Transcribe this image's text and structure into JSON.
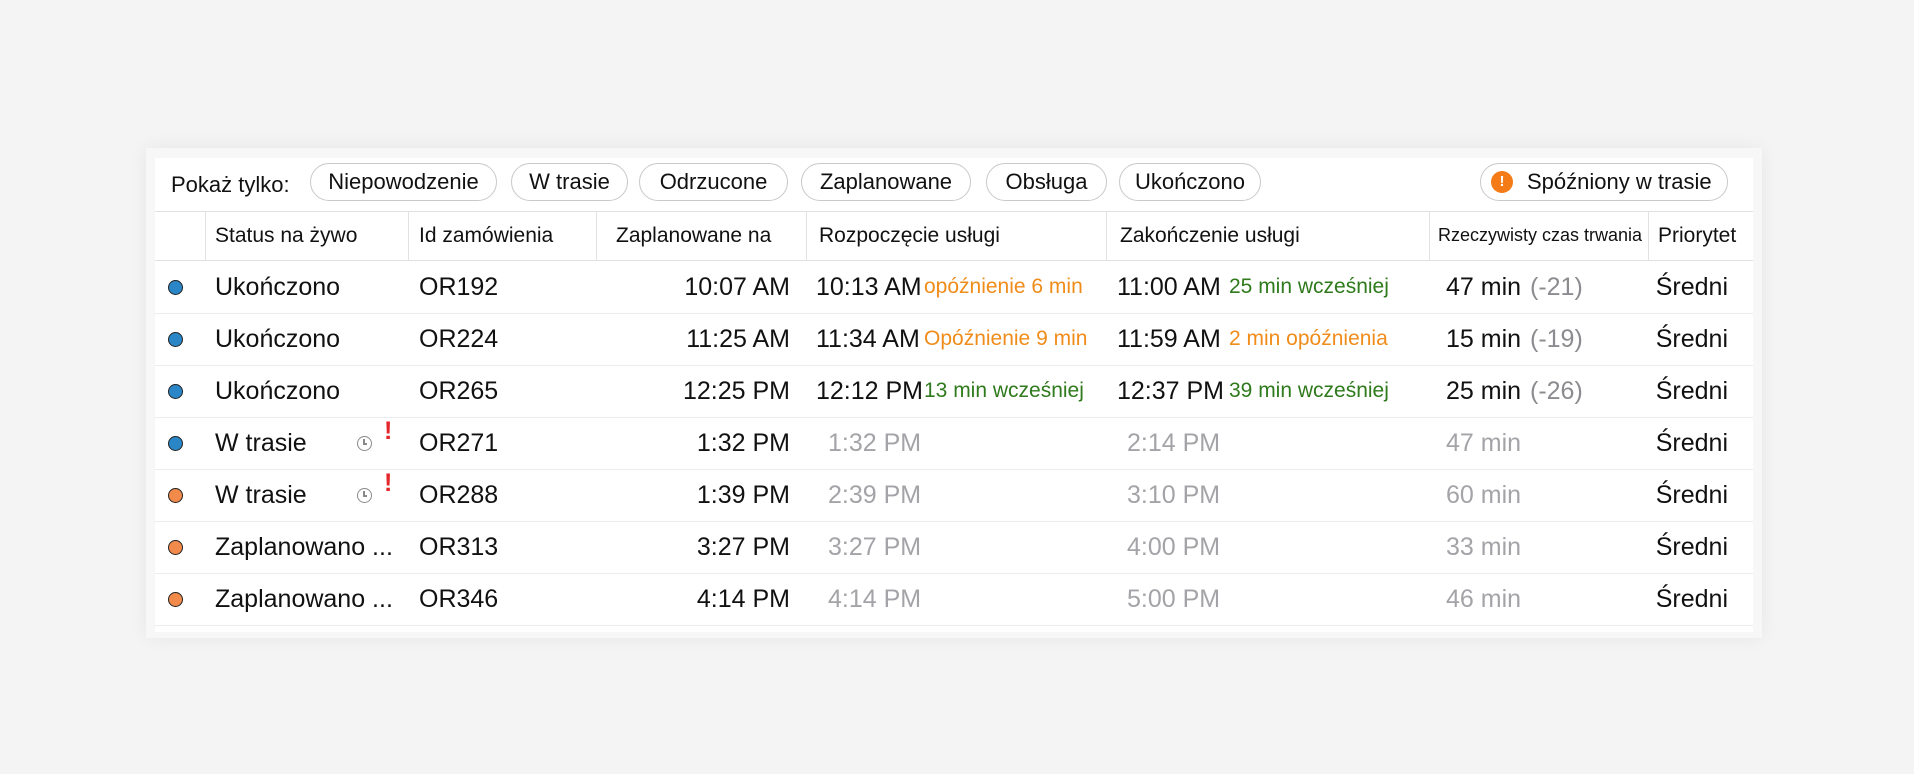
{
  "colors": {
    "accent_orange": "#f08c1a",
    "early_green": "#2f7a1c",
    "dot_blue": "#2a86c7",
    "dot_orange": "#f28a4b",
    "alert_red": "#e4262b",
    "muted_gray": "#a4a4a8"
  },
  "filters": {
    "label": "Pokaż tylko:",
    "chips": [
      "Niepowodzenie",
      "W trasie",
      "Odrzucone",
      "Zaplanowane",
      "Obsługa",
      "Ukończono"
    ],
    "late_chip": {
      "icon": "warning-icon",
      "icon_glyph": "!",
      "label": "Spóźniony w trasie"
    }
  },
  "table": {
    "headers": {
      "status": "Status na żywo",
      "order_id": "Id zamówienia",
      "scheduled": "Zaplanowane na",
      "start": "Rozpoczęcie usługi",
      "end": "Zakończenie usługi",
      "duration": "Rzeczywisty czas trwania",
      "priority": "Priorytet"
    },
    "rows": [
      {
        "dot": "blue",
        "status": "Ukończono",
        "icons": false,
        "order_id": "OR192",
        "scheduled": "10:07 AM",
        "start": "10:13 AM",
        "start_note": "opóźnienie 6 min",
        "start_note_color": "orange",
        "start_muted": false,
        "end": "11:00 AM",
        "end_note": "25 min wcześniej",
        "end_note_color": "green",
        "end_muted": false,
        "duration": "47 min",
        "duration_delta": "(-21)",
        "duration_muted": false,
        "priority": "Średni"
      },
      {
        "dot": "blue",
        "status": "Ukończono",
        "icons": false,
        "order_id": "OR224",
        "scheduled": "11:25 AM",
        "start": "11:34 AM",
        "start_note": "Opóźnienie 9 min",
        "start_note_color": "orange",
        "start_muted": false,
        "end": "11:59 AM",
        "end_note": "2 min opóźnienia",
        "end_note_color": "orange",
        "end_muted": false,
        "duration": "15 min",
        "duration_delta": "(-19)",
        "duration_muted": false,
        "priority": "Średni"
      },
      {
        "dot": "blue",
        "status": "Ukończono",
        "icons": false,
        "order_id": "OR265",
        "scheduled": "12:25 PM",
        "start": "12:12 PM",
        "start_note": "13 min wcześniej",
        "start_note_color": "green",
        "start_muted": false,
        "end": "12:37 PM",
        "end_note": "39 min wcześniej",
        "end_note_color": "green",
        "end_muted": false,
        "duration": "25 min",
        "duration_delta": "(-26)",
        "duration_muted": false,
        "priority": "Średni"
      },
      {
        "dot": "blue",
        "status": "W trasie",
        "icons": true,
        "order_id": "OR271",
        "scheduled": "1:32 PM",
        "start": "1:32 PM",
        "start_note": "",
        "start_note_color": "",
        "start_muted": true,
        "end": "2:14 PM",
        "end_note": "",
        "end_note_color": "",
        "end_muted": true,
        "duration": "47 min",
        "duration_delta": "",
        "duration_muted": true,
        "priority": "Średni"
      },
      {
        "dot": "orange",
        "status": "W trasie",
        "icons": true,
        "order_id": "OR288",
        "scheduled": "1:39 PM",
        "start": "2:39 PM",
        "start_note": "",
        "start_note_color": "",
        "start_muted": true,
        "end": "3:10 PM",
        "end_note": "",
        "end_note_color": "",
        "end_muted": true,
        "duration": "60 min",
        "duration_delta": "",
        "duration_muted": true,
        "priority": "Średni"
      },
      {
        "dot": "orange",
        "status": "Zaplanowano ...",
        "icons": false,
        "order_id": "OR313",
        "scheduled": "3:27 PM",
        "start": "3:27 PM",
        "start_note": "",
        "start_note_color": "",
        "start_muted": true,
        "end": "4:00 PM",
        "end_note": "",
        "end_note_color": "",
        "end_muted": true,
        "duration": "33 min",
        "duration_delta": "",
        "duration_muted": true,
        "priority": "Średni"
      },
      {
        "dot": "orange",
        "status": "Zaplanowano ...",
        "icons": false,
        "order_id": "OR346",
        "scheduled": "4:14 PM",
        "start": "4:14 PM",
        "start_note": "",
        "start_note_color": "",
        "start_muted": true,
        "end": "5:00 PM",
        "end_note": "",
        "end_note_color": "",
        "end_muted": true,
        "duration": "46 min",
        "duration_delta": "",
        "duration_muted": true,
        "priority": "Średni"
      }
    ]
  }
}
